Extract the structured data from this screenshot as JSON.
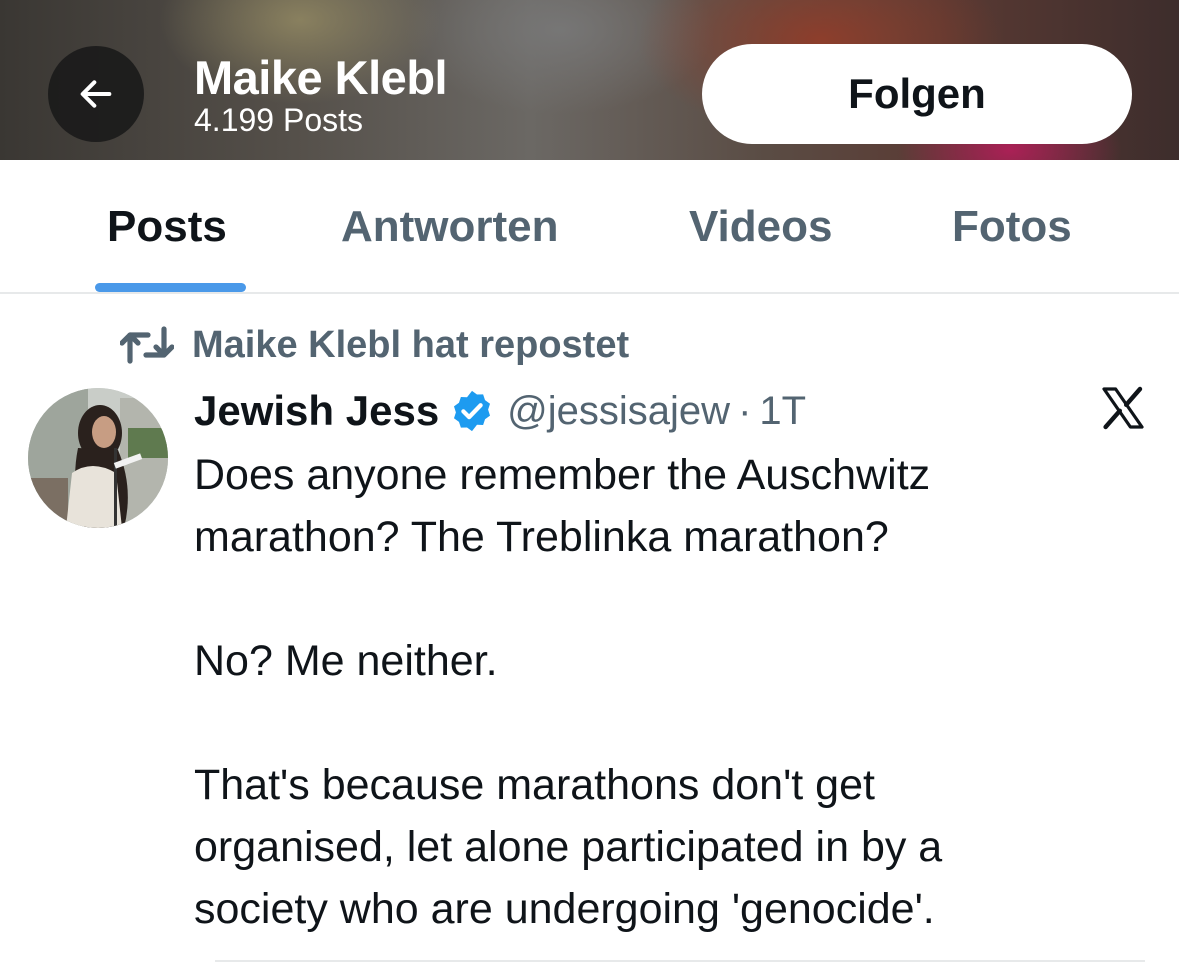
{
  "header": {
    "profile_name": "Maike Klebl",
    "post_count": "4.199 Posts",
    "back_icon": "arrow-left-icon",
    "follow_label": "Folgen"
  },
  "tabs": [
    {
      "label": "Posts",
      "active": true
    },
    {
      "label": "Antworten",
      "active": false
    },
    {
      "label": "Videos",
      "active": false
    },
    {
      "label": "Fotos",
      "active": false
    }
  ],
  "tweet": {
    "repost_icon": "repost-icon",
    "repost_label": "Maike Klebl hat repostet",
    "author_name": "Jewish Jess",
    "verified_icon": "verified-badge-icon",
    "handle": "@jessisajew",
    "separator": "·",
    "time": "1T",
    "platform_icon": "x-logo-icon",
    "lines": [
      "Does anyone remember the Auschwitz",
      "marathon? The Treblinka marathon?",
      "No? Me neither.",
      "That's because marathons don't get",
      "organised, let alone participated in by a",
      "society who are undergoing 'genocide'."
    ]
  },
  "colors": {
    "accent": "#4a99e9",
    "verified": "#1d9bf0",
    "secondary_text": "#536471",
    "primary_text": "#0f1419"
  }
}
